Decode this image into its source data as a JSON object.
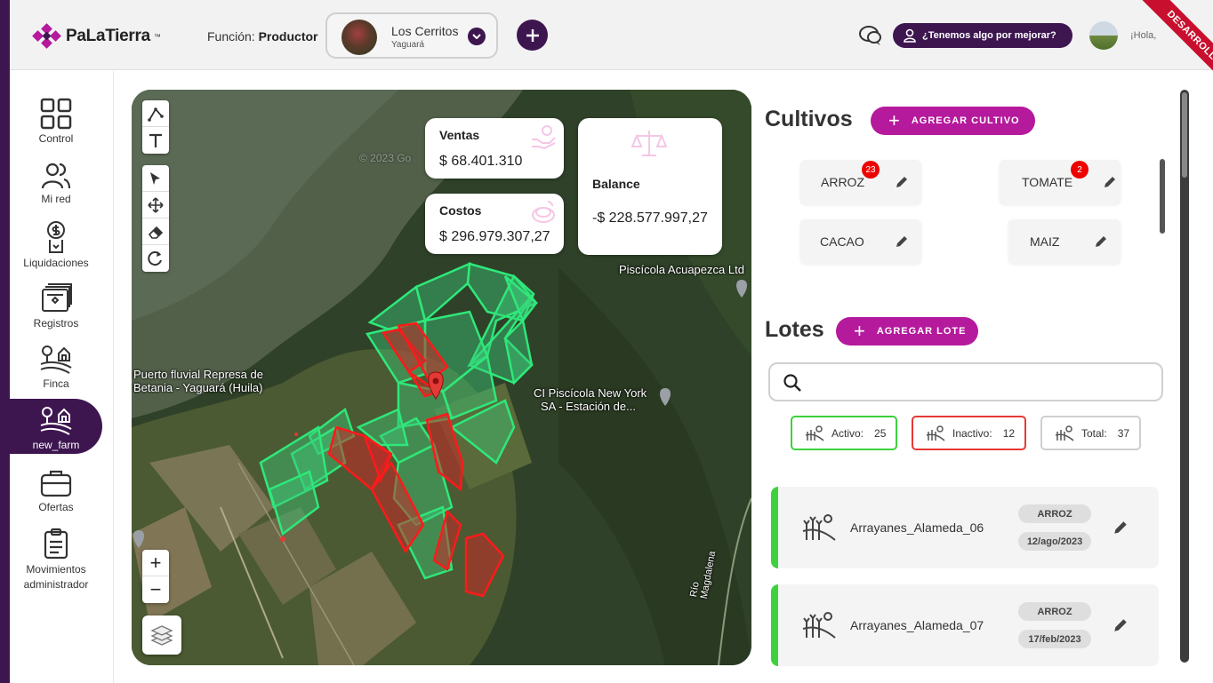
{
  "header": {
    "logo_text": "PaLaTierra",
    "logo_tm": "™",
    "funcion_label": "Función:",
    "funcion_value": "Productor",
    "farm_name": "Los Cerritos",
    "farm_location": "Yaguará",
    "improve_label": "¿Tenemos algo por mejorar?",
    "greeting": "¡Hola,",
    "env_ribbon": "DESARROLLO",
    "brand_color": "#3d1650",
    "accent_color": "#b5199c"
  },
  "sidebar": {
    "items": [
      {
        "label": "Control",
        "icon": "grid-icon"
      },
      {
        "label": "Mi red",
        "icon": "users-icon"
      },
      {
        "label": "Liquidaciones",
        "icon": "money-file-icon"
      },
      {
        "label": "Registros",
        "icon": "records-icon"
      },
      {
        "label": "Finca",
        "icon": "farm-icon"
      },
      {
        "label": "new_farm",
        "icon": "farm-icon",
        "active": true
      },
      {
        "label": "Ofertas",
        "icon": "briefcase-icon"
      },
      {
        "label": "Movimientos administrador",
        "icon": "clipboard-icon"
      }
    ]
  },
  "map": {
    "cards": {
      "ventas_label": "Ventas",
      "ventas_value": "$ 68.401.310",
      "costos_label": "Costos",
      "costos_value": "$ 296.979.307,27",
      "balance_label": "Balance",
      "balance_value": "-$ 228.577.997,27"
    },
    "labels": {
      "piscicola_acuapezca": "Piscícola Acuapezca Ltd",
      "puerto_line1": "Puerto fluvial Represa de",
      "puerto_line2": "Betania - Yaguará (Huila)",
      "newyork_line1": "CI Piscícola New York",
      "newyork_line2": "SA - Estación de...",
      "rio": "Río Magdalena",
      "copyright": "© 2023 Go"
    },
    "zoom_in": "+",
    "zoom_out": "−"
  },
  "cultivos": {
    "title": "Cultivos",
    "add_label": "AGREGAR CULTIVO",
    "items": [
      {
        "name": "ARROZ",
        "badge": "23"
      },
      {
        "name": "TOMATE",
        "badge": "2"
      },
      {
        "name": "CACAO",
        "badge": ""
      },
      {
        "name": "MAIZ",
        "badge": ""
      }
    ]
  },
  "lotes": {
    "title": "Lotes",
    "add_label": "AGREGAR LOTE",
    "search_placeholder": "",
    "filters": {
      "activo_label": "Activo:",
      "activo_count": "25",
      "inactivo_label": "Inactivo:",
      "inactivo_count": "12",
      "total_label": "Total:",
      "total_count": "37"
    },
    "items": [
      {
        "name": "Arrayanes_Alameda_06",
        "crop": "ARROZ",
        "date": "12/ago/2023"
      },
      {
        "name": "Arrayanes_Alameda_07",
        "crop": "ARROZ",
        "date": "17/feb/2023"
      }
    ]
  }
}
